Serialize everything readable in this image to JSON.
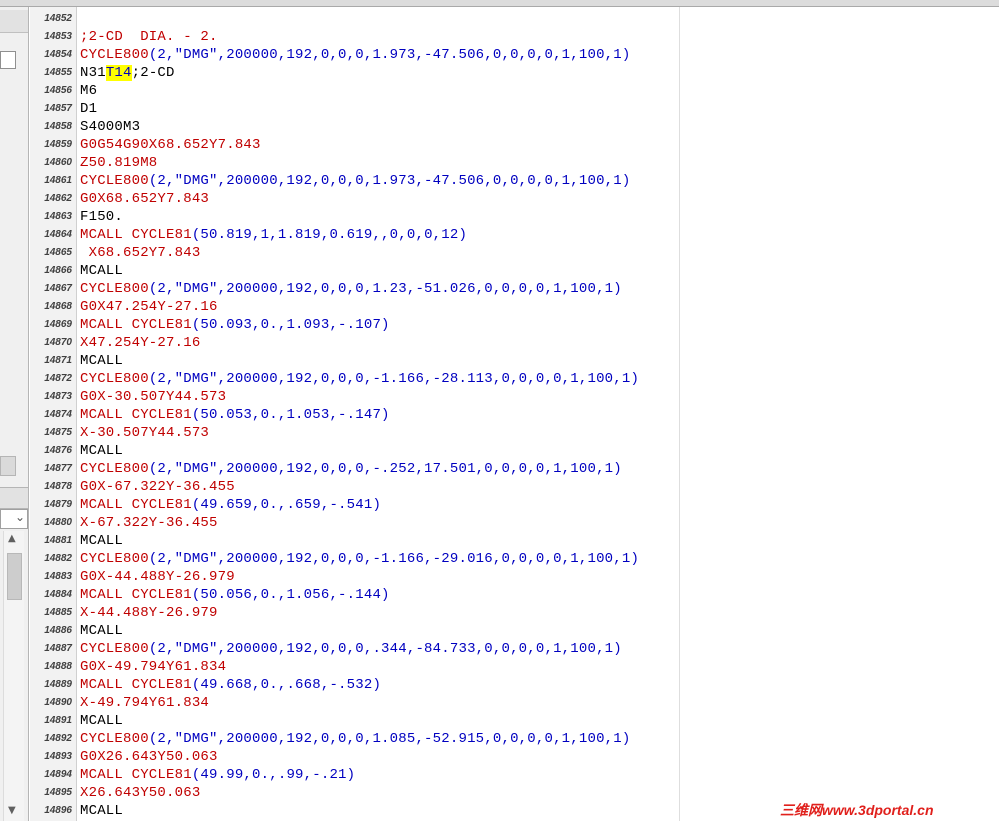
{
  "colors": {
    "red": "#c00000",
    "blue": "#0000c0",
    "black": "#000000",
    "highlight": "#ffff00"
  },
  "editor": {
    "lines": [
      {
        "num": "14852",
        "segs": []
      },
      {
        "num": "14853",
        "segs": [
          {
            "t": ";2-CD  DIA. - 2.",
            "c": "red"
          }
        ]
      },
      {
        "num": "14854",
        "segs": [
          {
            "t": "CYCLE800",
            "c": "red"
          },
          {
            "t": "(2,\"DMG\",200000,192,0,0,0,1.973,-47.506,0,0,0,0,1,100,1)",
            "c": "blue"
          }
        ]
      },
      {
        "num": "14855",
        "segs": [
          {
            "t": "N31",
            "c": "black"
          },
          {
            "t": "T14",
            "c": "blue",
            "hl": true
          },
          {
            "t": ";2-CD",
            "c": "black"
          }
        ]
      },
      {
        "num": "14856",
        "segs": [
          {
            "t": "M6",
            "c": "black"
          }
        ]
      },
      {
        "num": "14857",
        "segs": [
          {
            "t": "D1",
            "c": "black"
          }
        ]
      },
      {
        "num": "14858",
        "segs": [
          {
            "t": "S4000M3",
            "c": "black"
          }
        ]
      },
      {
        "num": "14859",
        "segs": [
          {
            "t": "G0G54G90X68.652Y7.843",
            "c": "red"
          }
        ]
      },
      {
        "num": "14860",
        "segs": [
          {
            "t": "Z50.819M8",
            "c": "red"
          }
        ]
      },
      {
        "num": "14861",
        "segs": [
          {
            "t": "CYCLE800",
            "c": "red"
          },
          {
            "t": "(2,\"DMG\",200000,192,0,0,0,1.973,-47.506,0,0,0,0,1,100,1)",
            "c": "blue"
          }
        ]
      },
      {
        "num": "14862",
        "segs": [
          {
            "t": "G0X68.652Y7.843",
            "c": "red"
          }
        ]
      },
      {
        "num": "14863",
        "segs": [
          {
            "t": "F150.",
            "c": "black"
          }
        ]
      },
      {
        "num": "14864",
        "segs": [
          {
            "t": "MCALL CYCLE81",
            "c": "red"
          },
          {
            "t": "(50.819,1,1.819,0.619,,0,0,0,12)",
            "c": "blue"
          }
        ]
      },
      {
        "num": "14865",
        "segs": [
          {
            "t": " X68.652Y7.843",
            "c": "red"
          }
        ]
      },
      {
        "num": "14866",
        "segs": [
          {
            "t": "MCALL",
            "c": "black"
          }
        ]
      },
      {
        "num": "14867",
        "segs": [
          {
            "t": "CYCLE800",
            "c": "red"
          },
          {
            "t": "(2,\"DMG\",200000,192,0,0,0,1.23,-51.026,0,0,0,0,1,100,1)",
            "c": "blue"
          }
        ]
      },
      {
        "num": "14868",
        "segs": [
          {
            "t": "G0X47.254Y-27.16",
            "c": "red"
          }
        ]
      },
      {
        "num": "14869",
        "segs": [
          {
            "t": "MCALL CYCLE81",
            "c": "red"
          },
          {
            "t": "(50.093,0.,1.093,-.107)",
            "c": "blue"
          }
        ]
      },
      {
        "num": "14870",
        "segs": [
          {
            "t": "X47.254Y-27.16",
            "c": "red"
          }
        ]
      },
      {
        "num": "14871",
        "segs": [
          {
            "t": "MCALL",
            "c": "black"
          }
        ]
      },
      {
        "num": "14872",
        "segs": [
          {
            "t": "CYCLE800",
            "c": "red"
          },
          {
            "t": "(2,\"DMG\",200000,192,0,0,0,-1.166,-28.113,0,0,0,0,1,100,1)",
            "c": "blue"
          }
        ]
      },
      {
        "num": "14873",
        "segs": [
          {
            "t": "G0X-30.507Y44.573",
            "c": "red"
          }
        ]
      },
      {
        "num": "14874",
        "segs": [
          {
            "t": "MCALL CYCLE81",
            "c": "red"
          },
          {
            "t": "(50.053,0.,1.053,-.147)",
            "c": "blue"
          }
        ]
      },
      {
        "num": "14875",
        "segs": [
          {
            "t": "X-30.507Y44.573",
            "c": "red"
          }
        ]
      },
      {
        "num": "14876",
        "segs": [
          {
            "t": "MCALL",
            "c": "black"
          }
        ]
      },
      {
        "num": "14877",
        "segs": [
          {
            "t": "CYCLE800",
            "c": "red"
          },
          {
            "t": "(2,\"DMG\",200000,192,0,0,0,-.252,17.501,0,0,0,0,1,100,1)",
            "c": "blue"
          }
        ]
      },
      {
        "num": "14878",
        "segs": [
          {
            "t": "G0X-67.322Y-36.455",
            "c": "red"
          }
        ]
      },
      {
        "num": "14879",
        "segs": [
          {
            "t": "MCALL CYCLE81",
            "c": "red"
          },
          {
            "t": "(49.659,0.,.659,-.541)",
            "c": "blue"
          }
        ]
      },
      {
        "num": "14880",
        "segs": [
          {
            "t": "X-67.322Y-36.455",
            "c": "red"
          }
        ]
      },
      {
        "num": "14881",
        "segs": [
          {
            "t": "MCALL",
            "c": "black"
          }
        ]
      },
      {
        "num": "14882",
        "segs": [
          {
            "t": "CYCLE800",
            "c": "red"
          },
          {
            "t": "(2,\"DMG\",200000,192,0,0,0,-1.166,-29.016,0,0,0,0,1,100,1)",
            "c": "blue"
          }
        ]
      },
      {
        "num": "14883",
        "segs": [
          {
            "t": "G0X-44.488Y-26.979",
            "c": "red"
          }
        ]
      },
      {
        "num": "14884",
        "segs": [
          {
            "t": "MCALL CYCLE81",
            "c": "red"
          },
          {
            "t": "(50.056,0.,1.056,-.144)",
            "c": "blue"
          }
        ]
      },
      {
        "num": "14885",
        "segs": [
          {
            "t": "X-44.488Y-26.979",
            "c": "red"
          }
        ]
      },
      {
        "num": "14886",
        "segs": [
          {
            "t": "MCALL",
            "c": "black"
          }
        ]
      },
      {
        "num": "14887",
        "segs": [
          {
            "t": "CYCLE800",
            "c": "red"
          },
          {
            "t": "(2,\"DMG\",200000,192,0,0,0,.344,-84.733,0,0,0,0,1,100,1)",
            "c": "blue"
          }
        ]
      },
      {
        "num": "14888",
        "segs": [
          {
            "t": "G0X-49.794Y61.834",
            "c": "red"
          }
        ]
      },
      {
        "num": "14889",
        "segs": [
          {
            "t": "MCALL CYCLE81",
            "c": "red"
          },
          {
            "t": "(49.668,0.,.668,-.532)",
            "c": "blue"
          }
        ]
      },
      {
        "num": "14890",
        "segs": [
          {
            "t": "X-49.794Y61.834",
            "c": "red"
          }
        ]
      },
      {
        "num": "14891",
        "segs": [
          {
            "t": "MCALL",
            "c": "black"
          }
        ]
      },
      {
        "num": "14892",
        "segs": [
          {
            "t": "CYCLE800",
            "c": "red"
          },
          {
            "t": "(2,\"DMG\",200000,192,0,0,0,1.085,-52.915,0,0,0,0,1,100,1)",
            "c": "blue"
          }
        ]
      },
      {
        "num": "14893",
        "segs": [
          {
            "t": "G0X26.643Y50.063",
            "c": "red"
          }
        ]
      },
      {
        "num": "14894",
        "segs": [
          {
            "t": "MCALL CYCLE81",
            "c": "red"
          },
          {
            "t": "(49.99,0.,.99,-.21)",
            "c": "blue"
          }
        ]
      },
      {
        "num": "14895",
        "segs": [
          {
            "t": "X26.643Y50.063",
            "c": "red"
          }
        ]
      },
      {
        "num": "14896",
        "segs": [
          {
            "t": "MCALL",
            "c": "black"
          }
        ]
      }
    ]
  },
  "left_panel": {
    "combo_icon": "chevron-down-icon",
    "scroll_up_icon": "scroll-up-arrow-icon",
    "scroll_down_icon": "scroll-down-arrow-icon"
  },
  "watermark": {
    "text": "三维网www.3dportal.cn"
  }
}
